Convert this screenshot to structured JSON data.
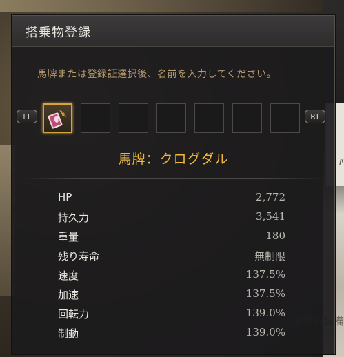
{
  "dialog": {
    "title": "搭乗物登録",
    "instruction": "馬牌または登録証選択後、名前を入力してください。"
  },
  "slots": {
    "left_trigger": "LT",
    "right_trigger": "RT",
    "count": 7,
    "selected_index": 0,
    "selected_icon": "horse-tag-icon"
  },
  "item": {
    "name": "馬牌：クログダル"
  },
  "stats": [
    {
      "label": "HP",
      "value": "2,772"
    },
    {
      "label": "持久力",
      "value": "3,541"
    },
    {
      "label": "重量",
      "value": "180"
    },
    {
      "label": "残り寿命",
      "value": "無制限"
    },
    {
      "label": "速度",
      "value": "137.5%"
    },
    {
      "label": "加速",
      "value": "137.5%"
    },
    {
      "label": "回転力",
      "value": "139.0%"
    },
    {
      "label": "制動",
      "value": "139.0%"
    }
  ],
  "background": {
    "right_text": "ﾊﾞ",
    "bottom_text": "搭乗物装備"
  },
  "colors": {
    "accent": "#f0b93e",
    "instruction": "#b79a6e",
    "selected_border": "#d4a441"
  }
}
